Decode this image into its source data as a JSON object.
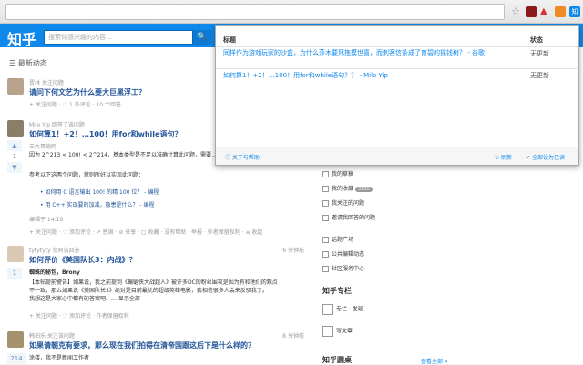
{
  "app": {
    "logo": "知乎",
    "search_placeholder": "搜索你感兴趣的内容...",
    "search_btn": "🔍"
  },
  "feed": {
    "header": "最新动态",
    "items": [
      {
        "source": "胥林 关注问题",
        "title": "请问下何文艺为什么要大巨黑浮工？",
        "meta": "+ 关注问题 · ♡ 1 条评论 · 10 个回答"
      },
      {
        "source": "Milo Yip 回答了该问题",
        "title": "如何算1！+2！…100！用for和while语句？",
        "votes": "1",
        "author": "王大哥聪网",
        "body1": "因为 2^213 < 100! < 2^214，基本类型是不足以准确计算此问题，需要…",
        "body2": "参考以下这两个问题，就则所好以实现此问题：",
        "bullet1": "• 如何用 C 语言输出 100! 的精 100 位？ - 编程",
        "bullet2": "• 用 C++ 实现要的加减，隐患是什么？ - 编程",
        "edited": "编辑于 14:19",
        "actions": "+ 关注问题 · ♡ 添加评论 · ↗ 感谢 · ⊘ 分享 · □ 收藏 · 没有帮助 · 举报 · 作者保留权利 · ≡ 收起"
      },
      {
        "source": "tytytyty 赞同该回答",
        "time": "6 分钟前",
        "title": "如何评价《美国队长3：内战》？",
        "votes": "1",
        "author": "蜘蛛的秘包，Brony",
        "body1": "【本帖提前警告】如果说，我之前提到《蝙蝠侠大战超人》被许多DC的粉丝围攻是因为有和他们的观点",
        "body2": "不一致，那么如果说《美国队长3》绝对是目前最优的超级英雄电影，我相信很多人会来反驳我了。",
        "body3": "我想这是大家心中都有的答案吧。… 显示全部",
        "actions": "+ 关注问题 · ♡ 添加评论 · 作者保留权利"
      },
      {
        "source": "韩柏乐 关注该问题",
        "time": "8 分钟前",
        "title": "如果请朝克有要求，那么现在我们拍得在清帝国跟这后下是什么样的？",
        "votes": "214",
        "author": "涂楼，我不是新闻工作者"
      }
    ]
  },
  "sidebar": {
    "items": [
      {
        "label": "我的草稿",
        "badge": ""
      },
      {
        "label": "我的收藏",
        "badge": "3150"
      },
      {
        "label": "我关注的问题",
        "badge": ""
      },
      {
        "label": "邀请我回答的问题",
        "badge": ""
      },
      {
        "label": "话题广场",
        "badge": ""
      },
      {
        "label": "公共编辑动态",
        "badge": ""
      },
      {
        "label": "社区服务中心",
        "badge": ""
      }
    ],
    "zhuanlan_head": "知乎专栏",
    "zhuanlan_item1": "专栏 · 发现",
    "zhuanlan_item2": "写文章",
    "round_head": "知乎圆桌",
    "round_more": "查看全部 »"
  },
  "popup": {
    "col_title": "标题",
    "col_status": "状态",
    "rows": [
      {
        "title": "同样作为游戏玩家的沙盒，为什么莎木要死拖摸世喜，而刺客信条成了育碧的摇钱树？ - 谷歌",
        "status": "无更新"
      },
      {
        "title": "如何算1！+2！…100！用for和while语句？？ - Milo Yip",
        "status": "无更新"
      }
    ],
    "footer_help": "关于与帮助",
    "footer_refresh": "刷新",
    "footer_markall": "全部设为已读"
  },
  "colors": {
    "brand": "#0f88eb",
    "link": "#225599"
  }
}
